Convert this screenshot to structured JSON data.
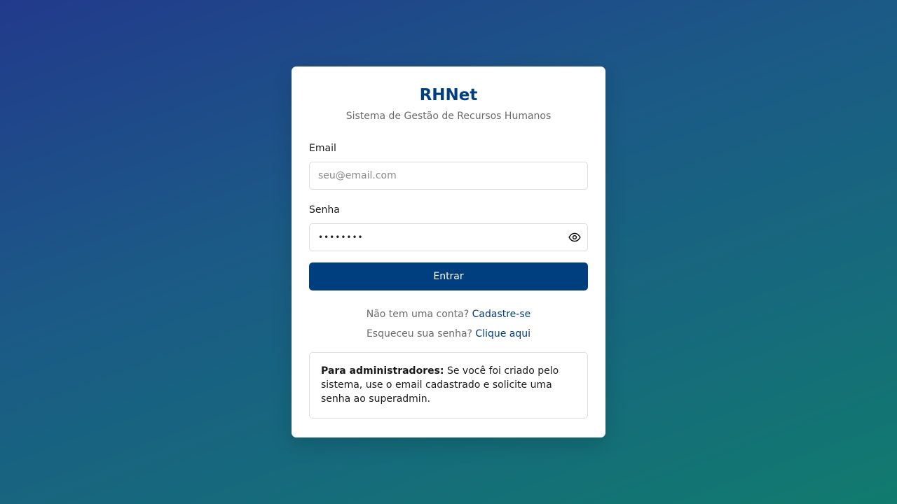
{
  "brand": {
    "title": "RHNet",
    "subtitle": "Sistema de Gestão de Recursos Humanos"
  },
  "form": {
    "email": {
      "label": "Email",
      "placeholder": "seu@email.com",
      "value": ""
    },
    "password": {
      "label": "Senha",
      "value": "••••••••",
      "toggle_icon": "eye-icon"
    },
    "submit_label": "Entrar"
  },
  "links": {
    "signup_prompt": "Não tem uma conta?",
    "signup_label": "Cadastre-se",
    "forgot_prompt": "Esqueceu sua senha?",
    "forgot_label": "Clique aqui"
  },
  "admin_note": {
    "title": "Para administradores:",
    "text": "Se você foi criado pelo sistema, use o email cadastrado e solicite uma senha ao superadmin."
  },
  "colors": {
    "primary": "#003f7f",
    "background_start": "#223a8c",
    "background_end": "#117b6e",
    "muted_text": "#6b6b6b"
  }
}
